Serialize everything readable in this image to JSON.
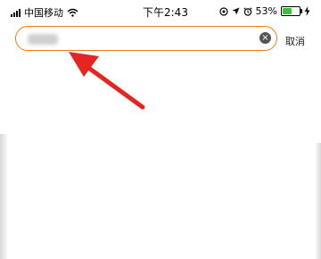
{
  "status_bar": {
    "carrier": "中国移动",
    "time": "下午2:43",
    "battery_percent": "53%",
    "battery_level": 0.53
  },
  "search": {
    "value": "",
    "placeholder": "",
    "clear_icon": "×"
  },
  "actions": {
    "cancel": "取消"
  },
  "colors": {
    "accent": "#f07b1b",
    "arrow": "#e52520",
    "battery_green": "#38c23f"
  },
  "icons": [
    "signal-icon",
    "wifi-icon",
    "location-lock-icon",
    "navigation-icon",
    "alarm-icon",
    "battery-icon",
    "charging-icon",
    "clear-icon",
    "annotation-arrow"
  ]
}
